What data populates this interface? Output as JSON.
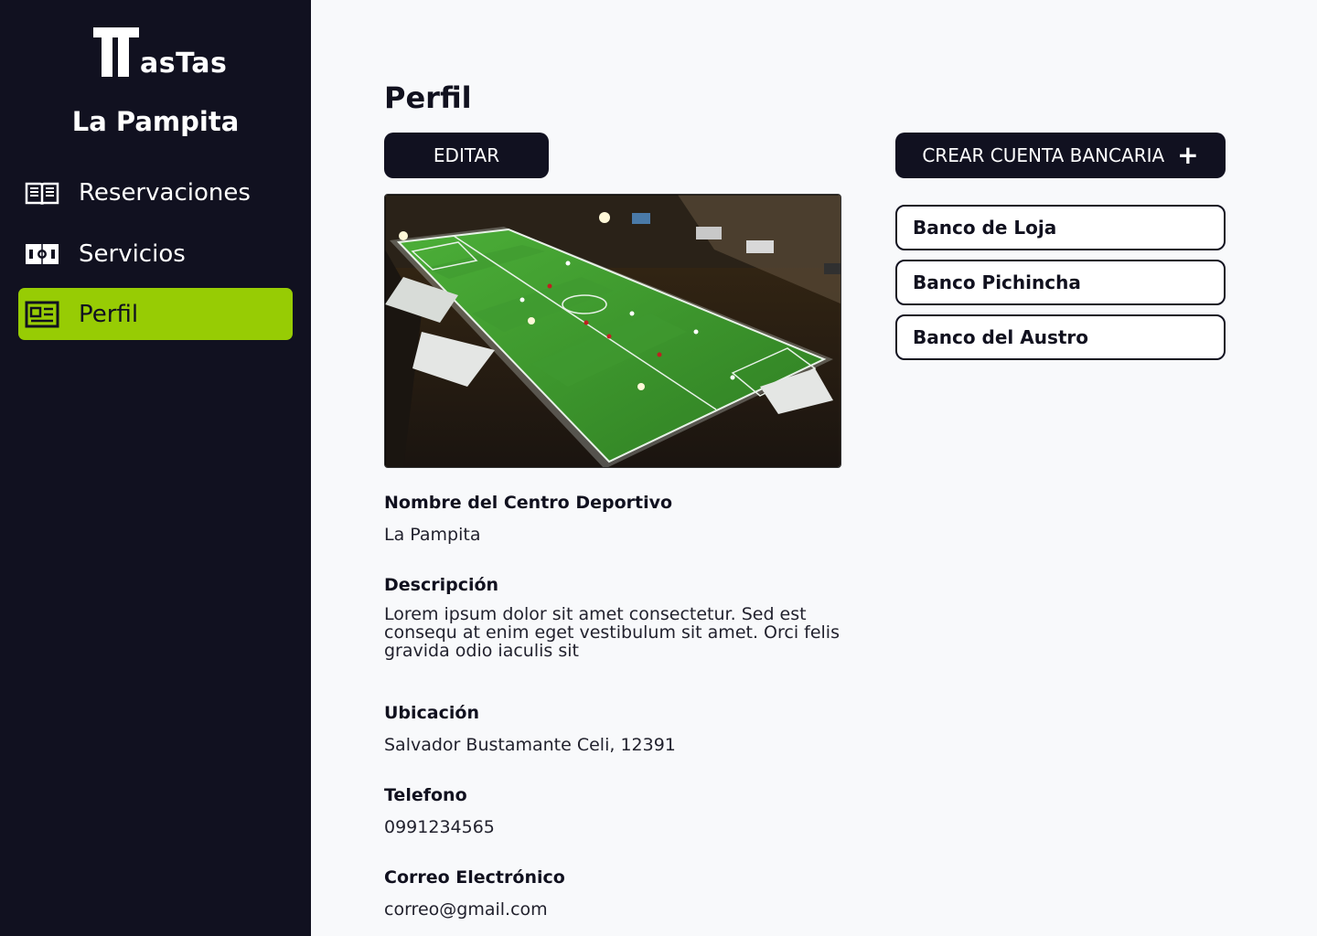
{
  "sidebar": {
    "logo_text": "asTas",
    "venue_name": "La Pampita",
    "items": [
      {
        "label": "Reservaciones",
        "icon": "book-icon",
        "active": false
      },
      {
        "label": "Servicios",
        "icon": "ticket-icon",
        "active": false
      },
      {
        "label": "Perfil",
        "icon": "id-card-icon",
        "active": true
      }
    ]
  },
  "colors": {
    "sidebar_bg": "#111120",
    "accent": "#97cc04",
    "page_bg": "#f8f9fb"
  },
  "main": {
    "title": "Perfil",
    "edit_label": "EDITAR",
    "photo_alt": "",
    "fields": [
      {
        "label": "Nombre del Centro Deportivo",
        "value": "La Pampita"
      },
      {
        "label": "Descripción",
        "value": "Lorem ipsum dolor sit amet consectetur. Sed est consequ at enim eget vestibulum sit amet. Orci felis gravida odio iaculis sit"
      },
      {
        "label": "Ubicación",
        "value": "Salvador Bustamante Celi, 12391"
      },
      {
        "label": "Telefono",
        "value": "0991234565"
      },
      {
        "label": "Correo Electrónico",
        "value": "correo@gmail.com"
      }
    ]
  },
  "banks": {
    "create_label": "CREAR CUENTA BANCARIA",
    "create_icon": "plus-icon",
    "accounts": [
      "Banco de Loja",
      "Banco Pichincha",
      "Banco del Austro"
    ]
  }
}
